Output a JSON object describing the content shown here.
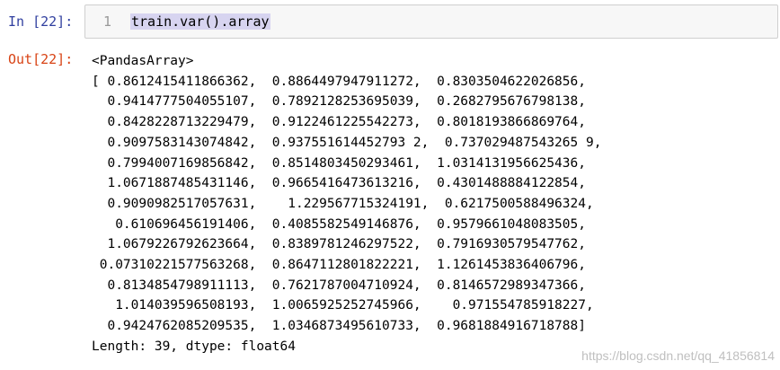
{
  "input": {
    "prompt": "In [22]:",
    "line_number": "1",
    "code": "train.var().array"
  },
  "output": {
    "prompt": "Out[22]:",
    "lines": [
      "<PandasArray>",
      "[ 0.8612415411866362,  0.8864497947911272,  0.8303504622026856,",
      "  0.9414777504055107,  0.7892128253695039,  0.2682795676798138,",
      "  0.8428228713229479,  0.9122461225542273,  0.8018193866869764,",
      "  0.9097583143074842,  0.937551614452793 2,  0.737029487543265 9,",
      "  0.7994007169856842,  0.8514803450293461,  1.0314131956625436,",
      "  1.0671887485431146,  0.9665416473613216,  0.4301488884122854,",
      "  0.9090982517057631,    1.229567715324191,  0.6217500588496324,",
      "   0.610696456191406,  0.4085582549146876,  0.9579661048083505,",
      "  1.0679226792623664,  0.8389781246297522,  0.7916930579547762,",
      " 0.07310221577563268,  0.8647112801822221,  1.1261453836406796,",
      "  0.8134854798911113,  0.7621787004710924,  0.8146572989347366,",
      "   1.014039596508193,  1.0065925252745966,    0.971554785918227,",
      "  0.9424762085209535,  1.0346873495610733,  0.9681884916718788]",
      "Length: 39, dtype: float64"
    ]
  },
  "watermark": "https://blog.csdn.net/qq_41856814"
}
